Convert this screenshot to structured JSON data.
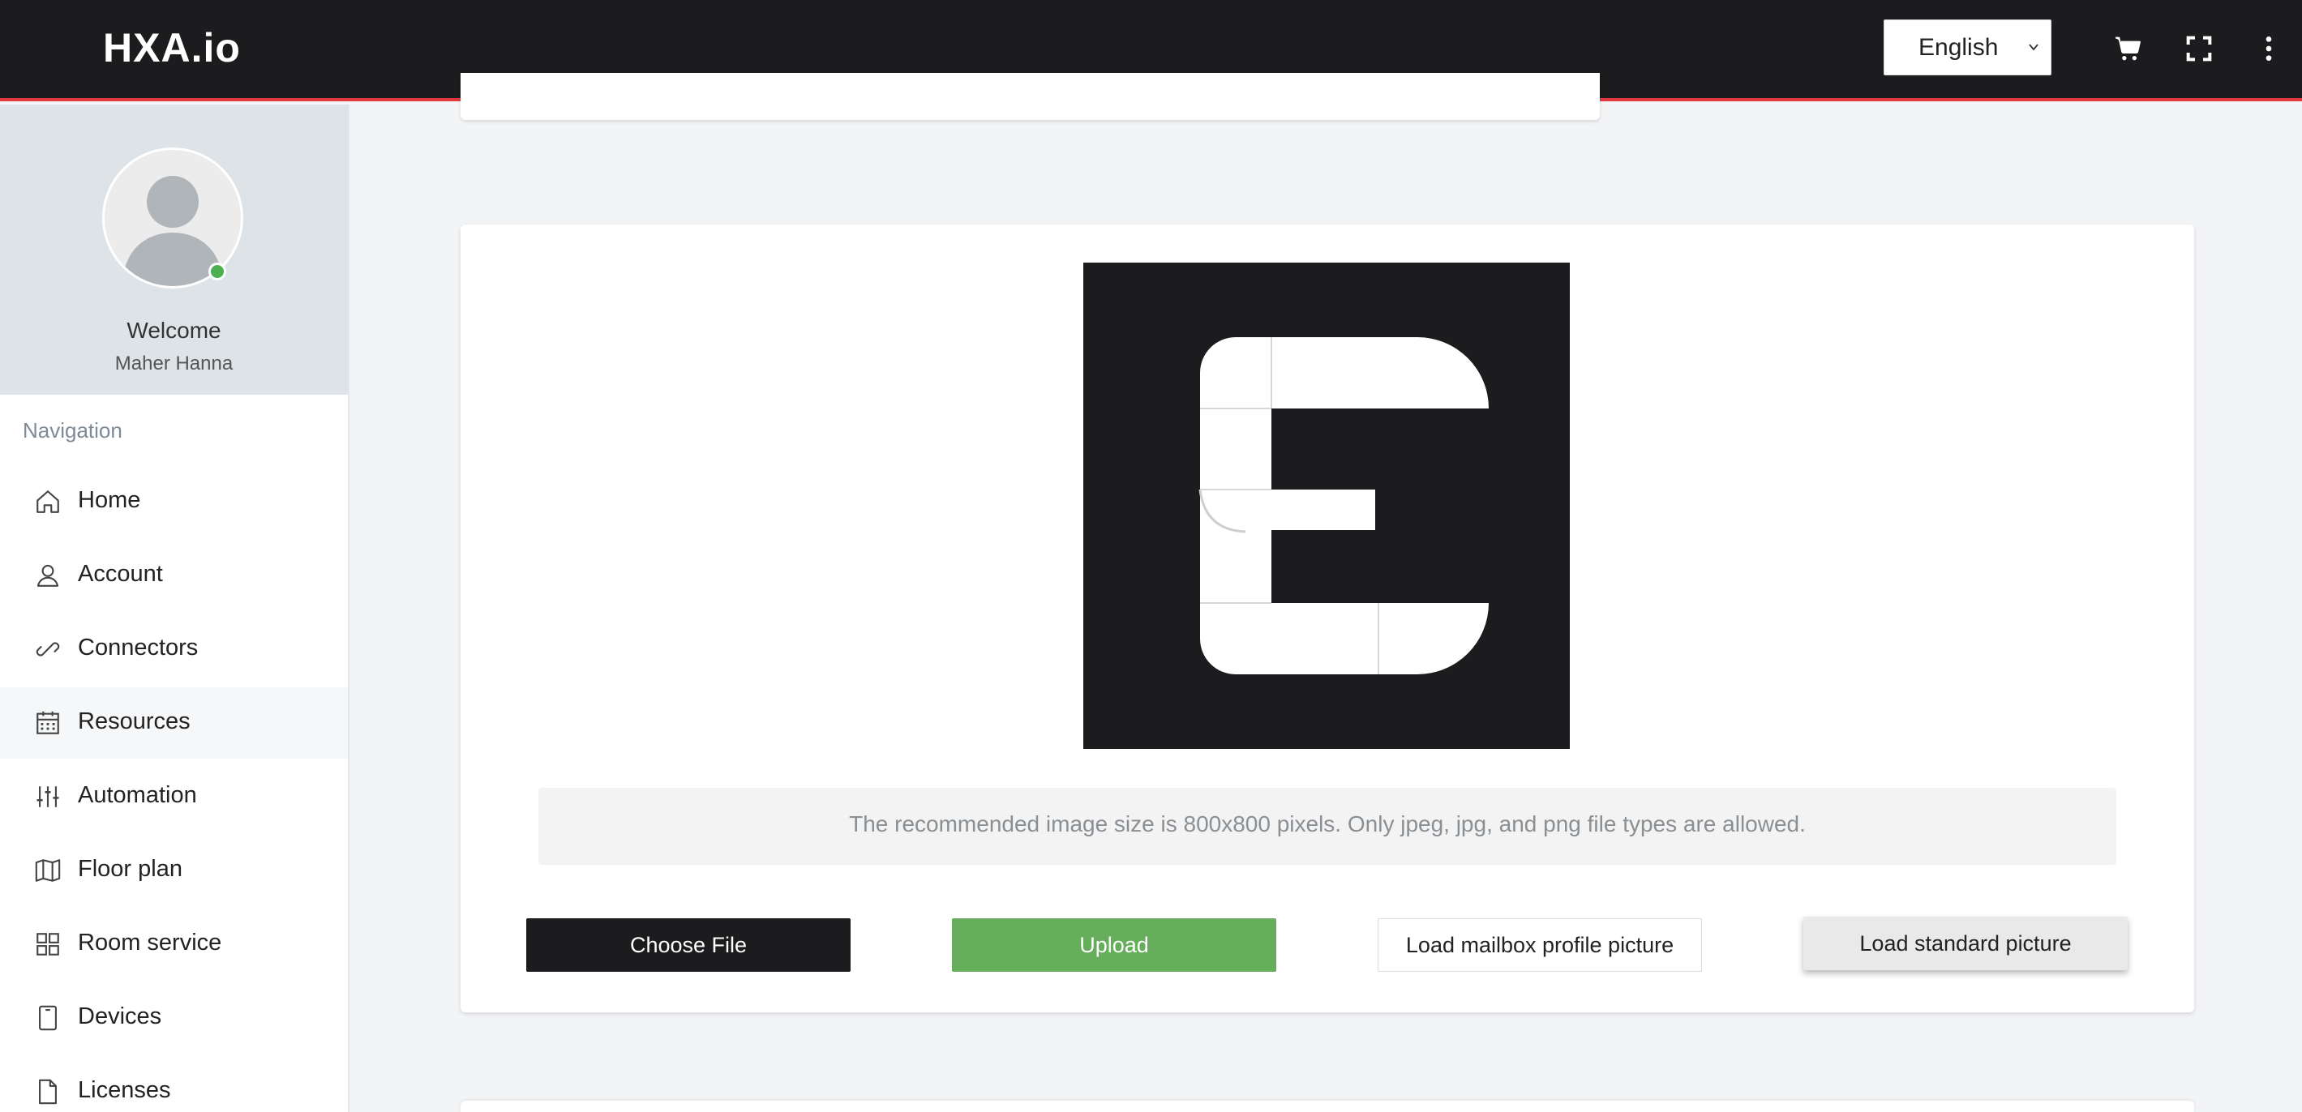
{
  "header": {
    "brand": "HXA.io",
    "language": "English",
    "icons": [
      "cart-icon",
      "fullscreen-icon",
      "more-vertical-icon"
    ]
  },
  "sidebar": {
    "welcome": "Welcome",
    "user_name": "Maher Hanna",
    "nav_heading": "Navigation",
    "items": [
      {
        "label": "Home",
        "icon": "home-icon"
      },
      {
        "label": "Account",
        "icon": "user-icon"
      },
      {
        "label": "Connectors",
        "icon": "link-icon"
      },
      {
        "label": "Resources",
        "icon": "calendar-icon",
        "active": true
      },
      {
        "label": "Automation",
        "icon": "sliders-icon"
      },
      {
        "label": "Floor plan",
        "icon": "map-icon"
      },
      {
        "label": "Room service",
        "icon": "grid-icon"
      },
      {
        "label": "Devices",
        "icon": "tablet-icon"
      },
      {
        "label": "Licenses",
        "icon": "file-icon"
      }
    ]
  },
  "main": {
    "info": "The recommended image size is 800x800 pixels. Only jpeg, jpg, and png file types are allowed.",
    "buttons": {
      "choose_file": "Choose File",
      "upload": "Upload",
      "load_mailbox": "Load mailbox profile picture",
      "load_standard": "Load standard picture"
    }
  },
  "colors": {
    "header_bg": "#1c1b1d",
    "header_accent": "#e0393e",
    "upload_green": "#66ae5b",
    "online_green": "#4caf50"
  }
}
